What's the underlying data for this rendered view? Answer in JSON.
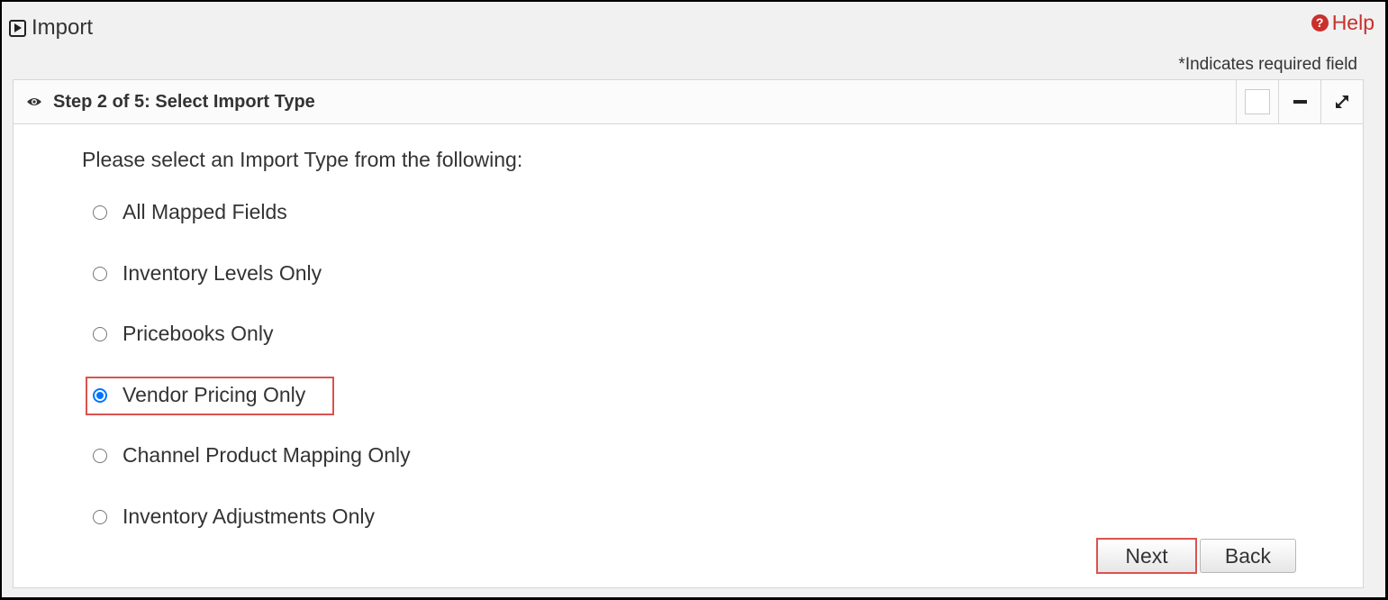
{
  "header": {
    "title": "Import",
    "help_label": "Help"
  },
  "required_note": "*Indicates required field",
  "panel": {
    "title": "Step 2 of 5: Select Import Type",
    "prompt": "Please select an Import Type from the following:",
    "options": [
      {
        "label": "All Mapped Fields",
        "checked": false
      },
      {
        "label": "Inventory Levels Only",
        "checked": false
      },
      {
        "label": "Pricebooks Only",
        "checked": false
      },
      {
        "label": "Vendor Pricing Only",
        "checked": true
      },
      {
        "label": "Channel Product Mapping Only",
        "checked": false
      },
      {
        "label": "Inventory Adjustments Only",
        "checked": false
      }
    ]
  },
  "buttons": {
    "next_label": "Next",
    "back_label": "Back"
  },
  "colors": {
    "accent_red": "#d9534f",
    "help_red": "#c9302c",
    "radio_blue": "#0075ff"
  },
  "icons": [
    "play-square-icon",
    "help-circle-icon",
    "eye-icon",
    "minimize-icon",
    "expand-icon"
  ]
}
